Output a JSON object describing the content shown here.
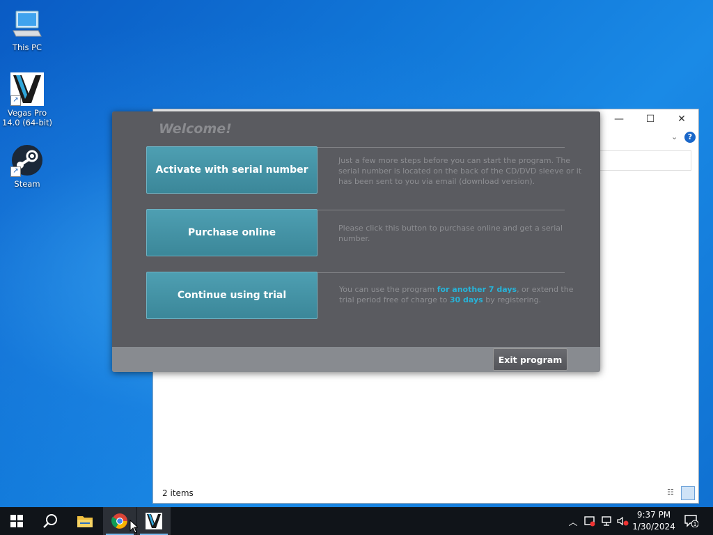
{
  "desktop": {
    "icons": [
      {
        "label": "This PC",
        "icon": "computer-icon"
      },
      {
        "label": "Vegas Pro 14.0 (64-bit)",
        "icon": "vegas-pro-icon"
      },
      {
        "label": "Steam",
        "icon": "steam-icon"
      }
    ]
  },
  "explorer": {
    "status": "2 items",
    "buttons": {
      "minimize": "—",
      "maximize": "☐",
      "close": "✕"
    },
    "help": "?"
  },
  "dialog": {
    "title": "Welcome!",
    "options": [
      {
        "label": "Activate with serial number",
        "description": "Just a few more steps before you can start the program. The serial number is located on the back of the CD/DVD sleeve or it has been sent to you via email (download version)."
      },
      {
        "label": "Purchase online",
        "description": "Please click this button to purchase online and get a serial number."
      },
      {
        "label": "Continue using trial",
        "desc_part1": "You can use the program ",
        "desc_hl1": "for another 7 days",
        "desc_part2": ", or extend the trial period free of charge to ",
        "desc_hl2": "30 days",
        "desc_part3": " by registering."
      }
    ],
    "exit_label": "Exit program",
    "colors": {
      "accent": "#27b3d8",
      "button": "#4599ac",
      "panel": "#5a5b60"
    }
  },
  "taskbar": {
    "apps": [
      "start-icon",
      "search-icon",
      "file-explorer-icon",
      "chrome-icon",
      "vegas-pro-icon"
    ],
    "time": "9:37 PM",
    "date": "1/30/2024",
    "notification_count": "1"
  }
}
